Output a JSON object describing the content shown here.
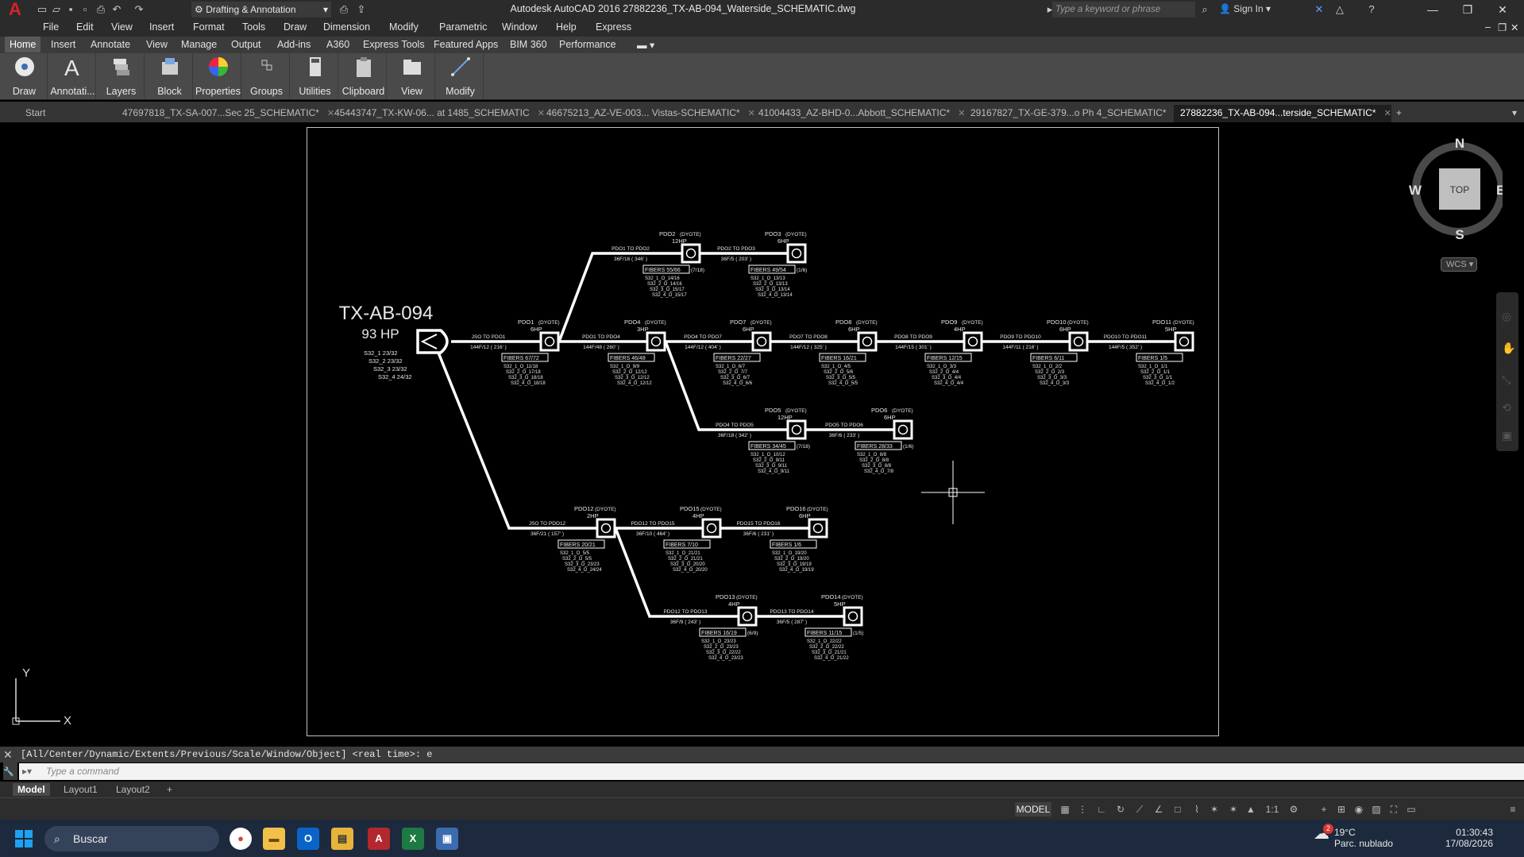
{
  "app": {
    "title": "Autodesk AutoCAD 2016   27882236_TX-AB-094_Waterside_SCHEMATIC.dwg",
    "workspace": "Drafting & Annotation",
    "search_placeholder": "Type a keyword or phrase",
    "signin_label": "Sign In"
  },
  "menubar": {
    "items": [
      "File",
      "Edit",
      "View",
      "Insert",
      "Format",
      "Tools",
      "Draw",
      "Dimension",
      "Modify",
      "Parametric",
      "Window",
      "Help",
      "Express"
    ]
  },
  "ribbon": {
    "tabs": [
      "Home",
      "Insert",
      "Annotate",
      "View",
      "Manage",
      "Output",
      "Add-ins",
      "A360",
      "Express Tools",
      "Featured Apps",
      "BIM 360",
      "Performance"
    ],
    "active_tab": "Home",
    "buttons": [
      "Draw",
      "Annotati...",
      "Layers",
      "Block",
      "Properties",
      "Groups",
      "Utilities",
      "Clipboard",
      "View",
      "Modify"
    ]
  },
  "doc_tabs": [
    {
      "label": "Start"
    },
    {
      "label": "47697818_TX-SA-007...Sec 25_SCHEMATIC*"
    },
    {
      "label": "45443747_TX-KW-06... at 1485_SCHEMATIC"
    },
    {
      "label": "46675213_AZ-VE-003... Vistas-SCHEMATIC*"
    },
    {
      "label": "41004433_AZ-BHD-0...Abbott_SCHEMATIC*"
    },
    {
      "label": "29167827_TX-GE-379...o Ph 4_SCHEMATIC*"
    },
    {
      "label": "27882236_TX-AB-094...terside_SCHEMATIC*"
    }
  ],
  "viewcube": {
    "north": "N",
    "south": "S",
    "east": "E",
    "west": "W",
    "face": "TOP",
    "wcs": "WCS"
  },
  "ucs": {
    "x": "X",
    "y": "Y"
  },
  "schematic": {
    "site_name": "TX-AB-094",
    "site_hp": "93 HP",
    "site_splitters": [
      "S32_1  23/32",
      "S32_2  23/32",
      "S32_3  23/32",
      "S32_4  24/32"
    ],
    "nodes": {
      "PDO1": {
        "name": "PDO1",
        "hp": "6HP",
        "fibers": "FIBERS   67/72",
        "extra": "",
        "details": [
          "S32_1_O_11/18",
          "S32_2_O_17/18",
          "S32_3_O_18/18",
          "S32_4_O_18/18"
        ]
      },
      "PDO2": {
        "name": "PDO2",
        "hp": "12HP",
        "fibers": "FIBERS   55/66",
        "extra": "(7/18)",
        "details": [
          "S32_1_O_14/16",
          "S32_2_O_14/16",
          "S32_3_O_15/17",
          "S32_4_O_15/17"
        ]
      },
      "PDO3": {
        "name": "PDO3",
        "hp": "6HP",
        "fibers": "FIBERS   49/54",
        "extra": "(1/6)",
        "details": [
          "S32_1_O_13/13",
          "S32_2_O_13/13",
          "S32_3_O_13/14",
          "S32_4_O_13/14"
        ]
      },
      "PDO4": {
        "name": "PDO4",
        "hp": "3HP",
        "fibers": "FIBERS   46/48",
        "extra": "",
        "details": [
          "S32_1_O_9/9",
          "S32_2_O_12/12",
          "S32_3_O_12/12",
          "S32_4_O_12/12"
        ]
      },
      "PDO5": {
        "name": "PDO5",
        "hp": "12HP",
        "fibers": "FIBERS   34/45",
        "extra": "(7/18)",
        "details": [
          "S32_1_O_10/12",
          "S32_2_O_9/11",
          "S32_3_O_9/11",
          "S32_4_O_9/11"
        ]
      },
      "PDO6": {
        "name": "PDO6",
        "hp": "6HP",
        "fibers": "FIBERS   28/33",
        "extra": "(1/6)",
        "details": [
          "S32_1_O_8/8",
          "S32_2_O_8/8",
          "S32_3_O_8/8",
          "S32_4_O_7/8"
        ]
      },
      "PDO7": {
        "name": "PDO7",
        "hp": "6HP",
        "fibers": "FIBERS   22/27",
        "extra": "",
        "details": [
          "S32_1_O_6/7",
          "S32_2_O_7/7",
          "S32_3_O_6/7",
          "S32_4_O_6/6"
        ]
      },
      "PDO8": {
        "name": "PDO8",
        "hp": "6HP",
        "fibers": "FIBERS   16/21",
        "extra": "",
        "details": [
          "S32_1_O_4/5",
          "S32_2_O_5/6",
          "S32_3_O_5/5",
          "S32_4_O_5/5"
        ]
      },
      "PDO9": {
        "name": "PDO9",
        "hp": "4HP",
        "fibers": "FIBERS   12/15",
        "extra": "",
        "details": [
          "S32_1_O_3/3",
          "S32_2_O_4/4",
          "S32_3_O_4/4",
          "S32_4_O_4/4"
        ]
      },
      "PDO10": {
        "name": "PDO10",
        "hp": "6HP",
        "fibers": "FIBERS   6/11",
        "extra": "",
        "details": [
          "S32_1_O_2/2",
          "S32_2_O_2/3",
          "S32_3_O_3/3",
          "S32_4_O_3/3"
        ]
      },
      "PDO11": {
        "name": "PDO11",
        "hp": "5HP",
        "fibers": "FIBERS   1/5",
        "extra": "",
        "details": [
          "S32_1_O_1/1",
          "S32_2_O_1/1",
          "S32_3_O_1/1",
          "S32_4_O_1/2"
        ]
      },
      "PDO12": {
        "name": "PDO12",
        "hp": "2HP",
        "fibers": "FIBERS   20/21",
        "extra": "",
        "details": [
          "S32_1_O_5/5",
          "S32_2_O_5/5",
          "S32_3_O_23/23",
          "S32_4_O_24/24"
        ]
      },
      "PDO13": {
        "name": "PDO13",
        "hp": "4HP",
        "fibers": "FIBERS   16/19",
        "extra": "(6/9)",
        "details": [
          "S32_1_O_23/23",
          "S32_2_O_23/23",
          "S32_3_O_22/22",
          "S32_4_O_23/23"
        ]
      },
      "PDO14": {
        "name": "PDO14",
        "hp": "5HP",
        "fibers": "FIBERS   11/15",
        "extra": "(1/5)",
        "details": [
          "S32_1_O_22/22",
          "S32_2_O_22/22",
          "S32_3_O_21/21",
          "S32_4_O_21/22"
        ]
      },
      "PDO15": {
        "name": "PDO15",
        "hp": "4HP",
        "fibers": "FIBERS   7/10",
        "extra": "",
        "details": [
          "S32_1_O_21/21",
          "S32_2_O_21/21",
          "S32_3_O_20/20",
          "S32_4_O_20/20"
        ]
      },
      "PDO16": {
        "name": "PDO16",
        "hp": "6HP",
        "fibers": "FIBERS   1/6",
        "extra": "",
        "details": [
          "S32_1_O_19/20",
          "S32_2_O_19/20",
          "S32_3_O_19/19",
          "S32_4_O_19/19"
        ]
      }
    },
    "node_tag": "(DYOTE)",
    "cables": [
      {
        "label": "JSO TO PDO1",
        "spec": "144F/12   ( 216' )"
      },
      {
        "label": "PDO1 TO PDO2",
        "spec": "36F/16   ( 346' )"
      },
      {
        "label": "PDO2 TO PDO3",
        "spec": "36F/5   ( 203' )"
      },
      {
        "label": "PDO1 TO PDO4",
        "spec": "144F/48   ( 260' )"
      },
      {
        "label": "PDO4 TO PDO7",
        "spec": "144F/12   ( 404' )"
      },
      {
        "label": "PDO7 TO PDO8",
        "spec": "144F/12   ( 325' )"
      },
      {
        "label": "PDO8 TO PDO9",
        "spec": "144F/15   ( 301' )"
      },
      {
        "label": "PDO9 TO PDO10",
        "spec": "144F/11   ( 216' )"
      },
      {
        "label": "PDO10 TO PDO11",
        "spec": "144F/5   ( 352' )"
      },
      {
        "label": "PDO4 TO PDO5",
        "spec": "36F/18   ( 342' )"
      },
      {
        "label": "PDO5 TO PDO6",
        "spec": "36F/6   ( 233' )"
      },
      {
        "label": "JSO TO PDO12",
        "spec": "36F/21   ( 157' )"
      },
      {
        "label": "PDO12 TO PDO15",
        "spec": "36F/10   ( 464' )"
      },
      {
        "label": "PDO15 TO PDO16",
        "spec": "36F/6   ( 231' )"
      },
      {
        "label": "PDO12 TO PDO13",
        "spec": "36F/9   ( 243' )"
      },
      {
        "label": "PDO13 TO PDO14",
        "spec": "36F/5   ( 287' )"
      }
    ]
  },
  "command": {
    "history": "[All/Center/Dynamic/Extents/Previous/Scale/Window/Object] <real time>: e",
    "placeholder": "Type a command"
  },
  "layout_tabs": [
    "Model",
    "Layout1",
    "Layout2"
  ],
  "status": {
    "model_label": "MODEL",
    "scale": "1:1"
  },
  "taskbar": {
    "search_label": "Buscar",
    "weather_temp": "19°C",
    "weather_desc": "Parc. nublado",
    "weather_badge": "2",
    "time": "01:30:43",
    "date": "17/08/2026"
  },
  "colors": {
    "accent_red": "#d8232a",
    "background": "#000000",
    "ribbon": "#4a4a4a",
    "taskbar": "#1d2a3d"
  }
}
